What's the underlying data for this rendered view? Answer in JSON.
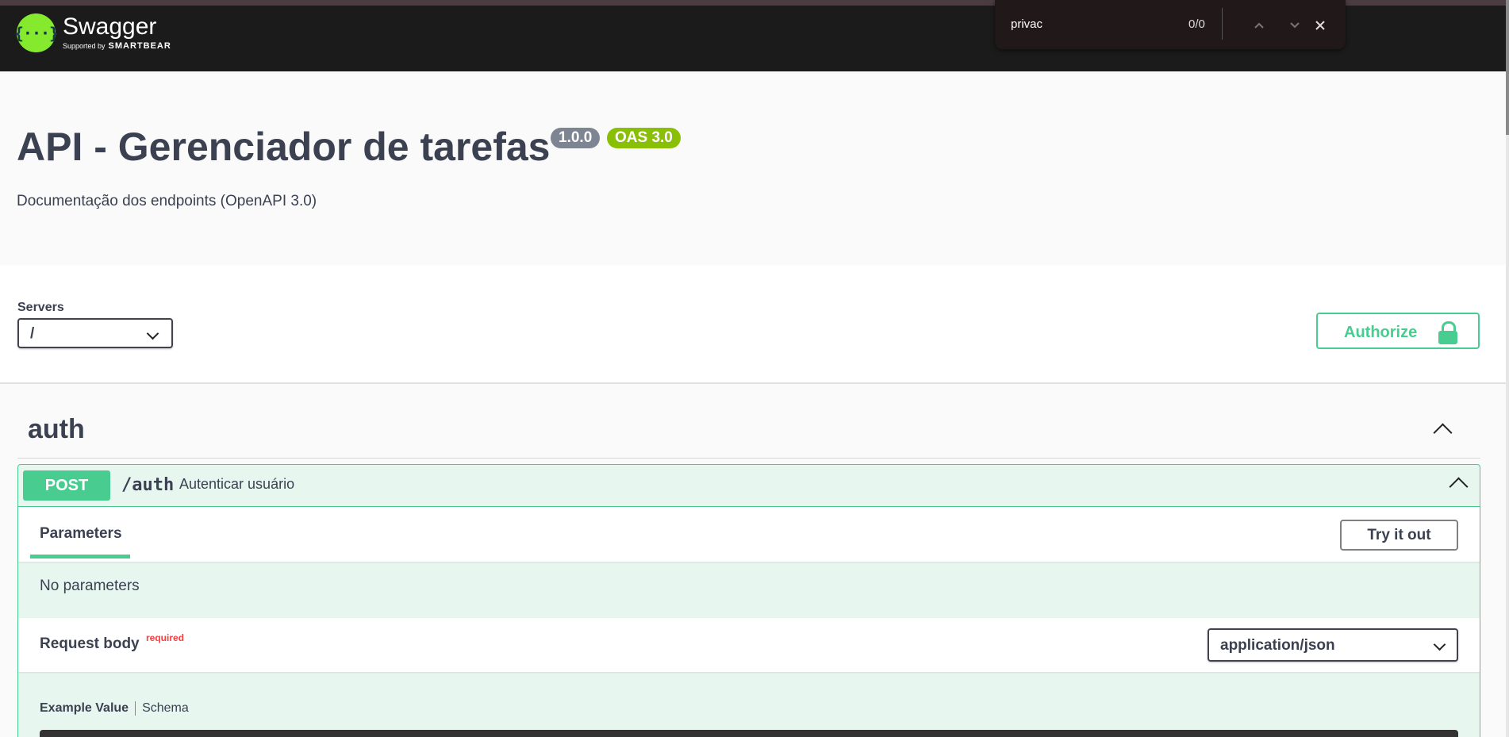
{
  "brand": {
    "logo_glyph": "{···}",
    "name": "Swagger",
    "tagline": "Supported by",
    "company": "SMARTBEAR"
  },
  "find_bar": {
    "query": "privac",
    "count": "0/0",
    "icons": [
      "chevron-up-icon",
      "chevron-down-icon",
      "close-icon"
    ]
  },
  "info": {
    "title": "API - Gerenciador de tarefas",
    "version": "1.0.0",
    "oas": "OAS 3.0",
    "description": "Documentação dos endpoints (OpenAPI 3.0)"
  },
  "servers": {
    "label": "Servers",
    "selected": "/"
  },
  "authorize": {
    "label": "Authorize",
    "icon": "lock-icon"
  },
  "tag": {
    "name": "auth",
    "operation": {
      "method": "POST",
      "path": "/auth",
      "summary": "Autenticar usuário",
      "parameters_tab": "Parameters",
      "try_it_out": "Try it out",
      "no_parameters": "No parameters",
      "request_body": "Request body",
      "required": "required",
      "content_type": "application/json",
      "example_value_tab": "Example Value",
      "schema_tab": "Schema"
    }
  },
  "colors": {
    "topbar": "#1b1b1b",
    "post_green": "#49cc90",
    "required_red": "#f93e3e",
    "version_badge": "#7d8492",
    "oas_badge": "#89bf04"
  }
}
